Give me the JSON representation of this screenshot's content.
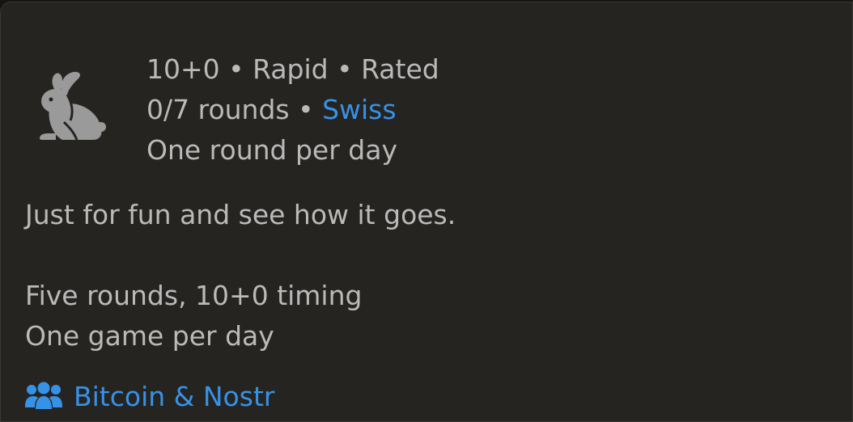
{
  "tournament": {
    "clock": "10+0",
    "speed": "Rapid",
    "rated": "Rated",
    "bullet": "•",
    "rounds": "0/7 rounds",
    "system": "Swiss",
    "schedule": "One round per day"
  },
  "description": {
    "line1": "Just for fun and see how it goes.",
    "line2": "Five rounds, 10+0 timing",
    "line3": "One game per day"
  },
  "team": {
    "name": "Bitcoin & Nostr",
    "icon": "team-icon"
  },
  "icons": {
    "variant": "rabbit-icon"
  },
  "colors": {
    "background": "#262421",
    "text": "#bababa",
    "link": "#3692e7",
    "icon": "#9a9a9a"
  }
}
